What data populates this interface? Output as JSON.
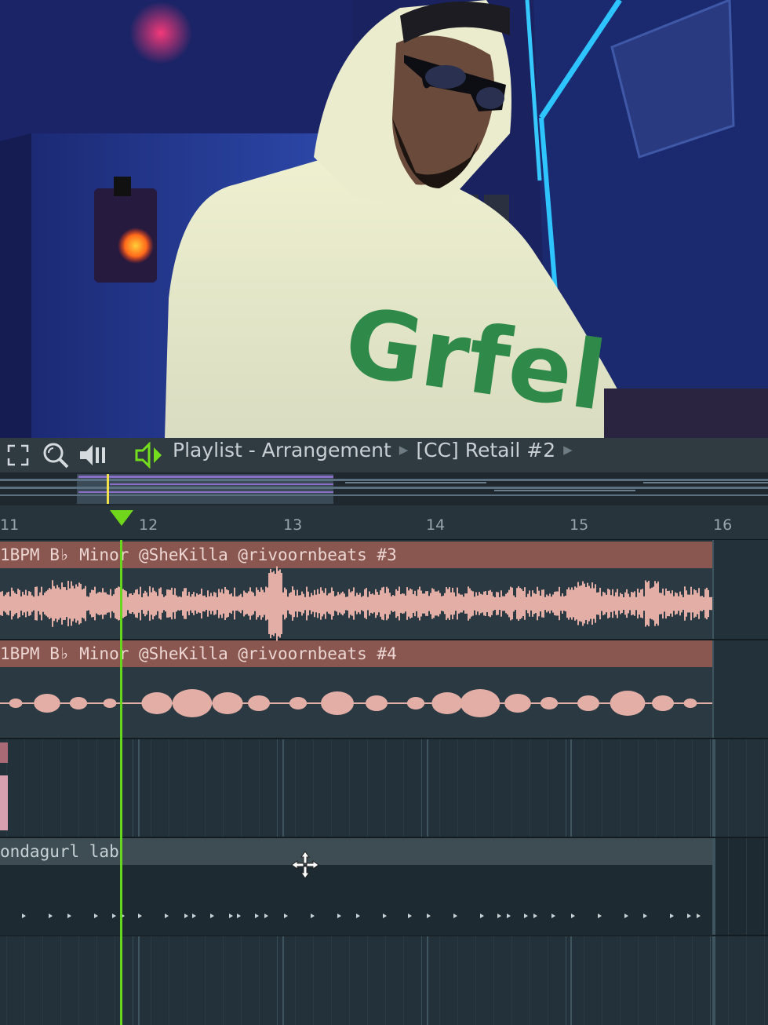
{
  "webcam": {
    "hoodie_text": "Grfel"
  },
  "toolbar": {
    "title": "Playlist - Arrangement",
    "pattern_name": "[CC] Retail #2",
    "icons": [
      "fullscreen-icon",
      "zoom-icon",
      "volume-icon",
      "speaker-icon"
    ]
  },
  "ruler": {
    "bars": [
      "11",
      "12",
      "13",
      "14",
      "15",
      "16"
    ]
  },
  "tracks": {
    "audio_clip_1": "1BPM B♭ Minor @SheKilla @rivoornbeats #3",
    "audio_clip_2": "1BPM B♭ Minor @SheKilla @rivoornbeats #4",
    "pattern_clip": "ondagurl lab"
  },
  "colors": {
    "accent": "#66d61f",
    "audio_clip_header": "#8a5650",
    "waveform": "#e2aea6",
    "toolbar": "#2f3a41"
  }
}
